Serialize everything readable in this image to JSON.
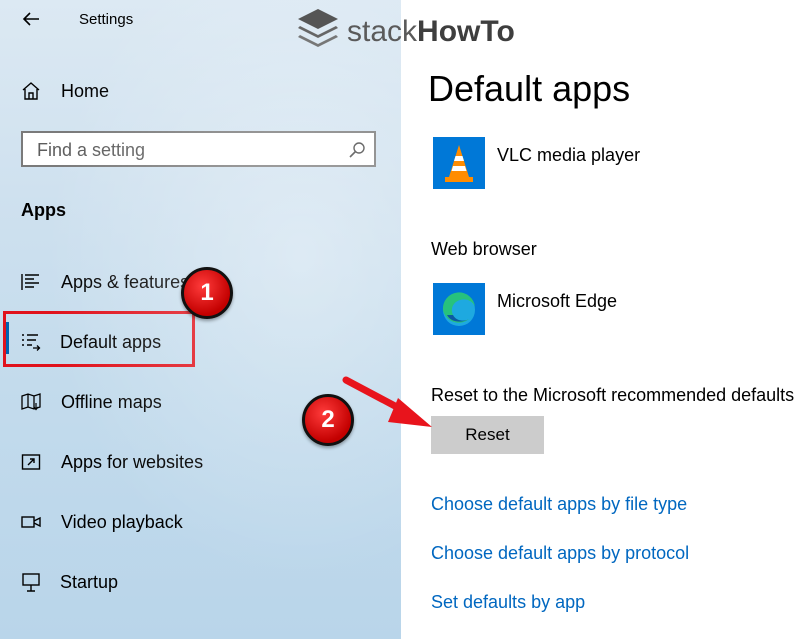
{
  "window": {
    "title": "Settings"
  },
  "watermark": {
    "text_light": "stack",
    "text_bold": "HowTo"
  },
  "sidebar": {
    "home_label": "Home",
    "search_placeholder": "Find a setting",
    "section_title": "Apps",
    "items": [
      {
        "label": "Apps & features",
        "icon": "list-icon"
      },
      {
        "label": "Default apps",
        "icon": "default-apps-icon",
        "selected": true
      },
      {
        "label": "Offline maps",
        "icon": "map-icon"
      },
      {
        "label": "Apps for websites",
        "icon": "web-link-icon"
      },
      {
        "label": "Video playback",
        "icon": "video-icon"
      },
      {
        "label": "Startup",
        "icon": "startup-icon"
      }
    ]
  },
  "main": {
    "title": "Default apps",
    "video_player": {
      "app_name": "VLC media player"
    },
    "web_browser": {
      "label": "Web browser",
      "app_name": "Microsoft Edge"
    },
    "reset": {
      "label": "Reset to the Microsoft recommended defaults",
      "button": "Reset"
    },
    "links": [
      "Choose default apps by file type",
      "Choose default apps by protocol",
      "Set defaults by app"
    ]
  },
  "annotations": {
    "badge_1": "1",
    "badge_2": "2"
  },
  "colors": {
    "accent": "#0063b1",
    "link": "#0067c0",
    "highlight": "#e0121c"
  }
}
